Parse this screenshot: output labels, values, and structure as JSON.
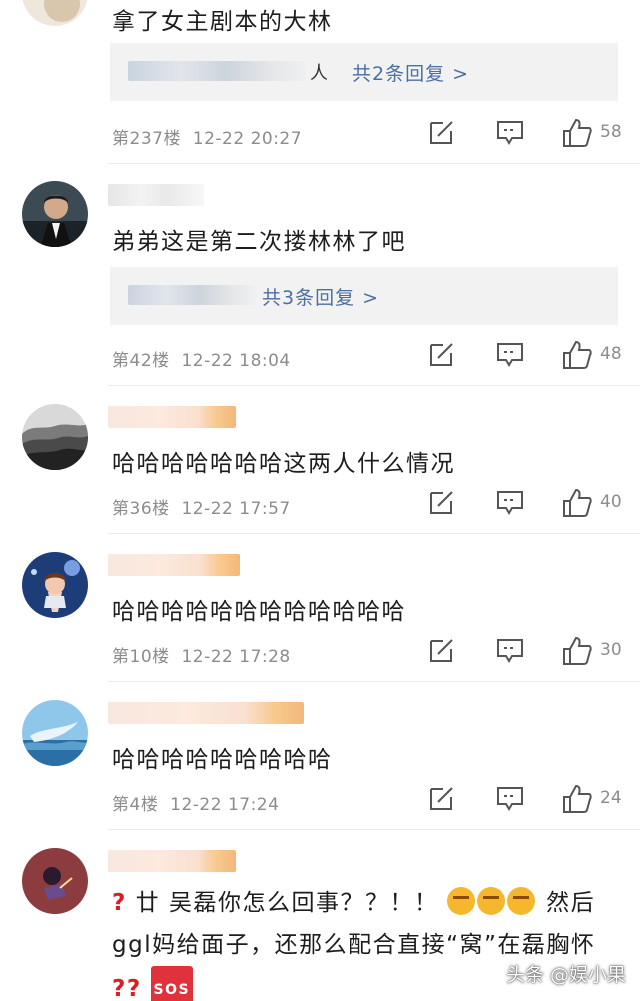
{
  "comments": [
    {
      "text": "拿了女主剧本的大林",
      "reply_suffix": "人",
      "reply_link": "共2条回复 >",
      "floor": "第237楼",
      "time": "12-22 20:27",
      "likes": "58"
    },
    {
      "text": "弟弟这是第二次搂林林了吧",
      "reply_link": "共3条回复 >",
      "floor": "第42楼",
      "time": "12-22 18:04",
      "likes": "48"
    },
    {
      "text": "哈哈哈哈哈哈哈这两人什么情况",
      "floor": "第36楼",
      "time": "12-22 17:57",
      "likes": "40"
    },
    {
      "text": "哈哈哈哈哈哈哈哈哈哈哈哈",
      "floor": "第10楼",
      "time": "12-22 17:28",
      "likes": "30"
    },
    {
      "text": "哈哈哈哈哈哈哈哈哈",
      "floor": "第4楼",
      "time": "12-22 17:24",
      "likes": "24"
    },
    {
      "text_a": "廿 吴磊你怎么回事？？！！",
      "text_b": "然后ggl妈给面子，还那么配合直接“窝”在磊胸怀",
      "sos": "SOS"
    }
  ],
  "watermark": "头条 @娱小果",
  "colors": {
    "link": "#4a6fa0",
    "meta": "#8c8c8c",
    "reply_bg": "#f2f2f2"
  },
  "icons": [
    "edit-icon",
    "comment-icon",
    "thumb-up-icon"
  ]
}
